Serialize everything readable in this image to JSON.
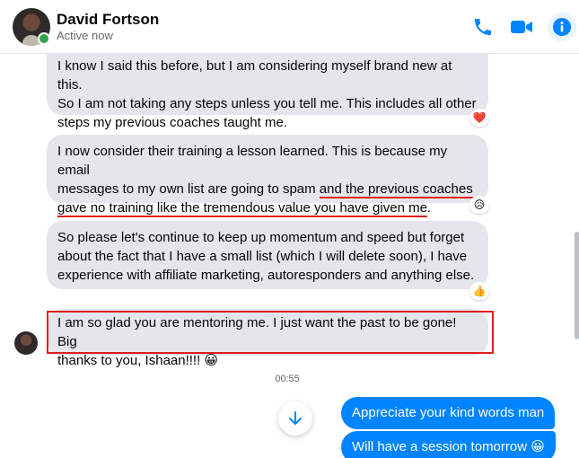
{
  "header": {
    "contact_name": "David Fortson",
    "status": "Active now",
    "icons": [
      "phone-icon",
      "video-camera-icon",
      "info-icon"
    ],
    "accent_color": "#0084ff"
  },
  "messages": [
    {
      "lines": [
        "I know I said this before, but I am considering myself brand new at this.",
        "So I am not taking any steps unless you tell me. This includes all other",
        "steps my previous coaches taught me."
      ],
      "reaction": "❤️"
    },
    {
      "line1": "I now consider their training a lesson learned. This is because my email",
      "line2_plain": "messages to my own list are going to spam ",
      "line2_underlined": "and the previous coaches",
      "line3_underlined": "gave no training like the tremendous value you have given me",
      "line3_end": ".",
      "reaction": "😥"
    },
    {
      "lines": [
        "So please let's continue to keep up momentum and speed but forget",
        "about the fact that I have a small list (which I will delete soon), I have",
        "experience with affiliate marketing, autoresponders and anything else."
      ],
      "reaction": "👍"
    },
    {
      "lines": [
        "I am so glad you are mentoring me. I just want the past to be gone! Big",
        "thanks to you, Ishaan!!!! 😀"
      ]
    }
  ],
  "timestamp": "00:55",
  "outgoing": [
    "Appreciate your kind words man",
    "Will have a session tomorrow 😀"
  ]
}
